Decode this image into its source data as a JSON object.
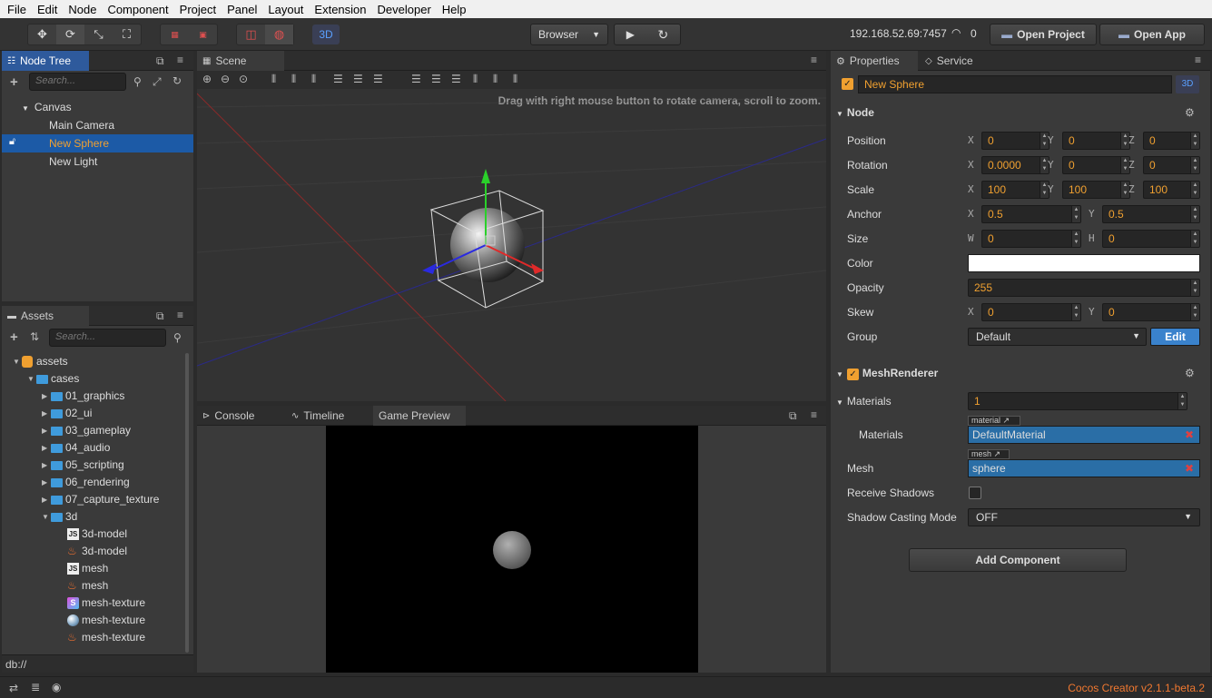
{
  "menu": [
    "File",
    "Edit",
    "Node",
    "Component",
    "Project",
    "Panel",
    "Layout",
    "Extension",
    "Developer",
    "Help"
  ],
  "toolbar": {
    "mode_3d": "3D",
    "preview_target": "Browser",
    "ip_address": "192.168.52.69:7457",
    "connections": "0",
    "open_project": "Open Project",
    "open_app": "Open App"
  },
  "node_tree": {
    "tab": "Node Tree",
    "search_placeholder": "Search...",
    "root": "Canvas",
    "children": [
      "Main Camera",
      "New Sphere",
      "New Light"
    ],
    "selected": "New Sphere"
  },
  "assets": {
    "tab": "Assets",
    "search_placeholder": "Search...",
    "items": [
      {
        "label": "assets",
        "kind": "root"
      },
      {
        "label": "cases",
        "kind": "folder"
      },
      {
        "label": "01_graphics",
        "kind": "folder"
      },
      {
        "label": "02_ui",
        "kind": "folder"
      },
      {
        "label": "03_gameplay",
        "kind": "folder"
      },
      {
        "label": "04_audio",
        "kind": "folder"
      },
      {
        "label": "05_scripting",
        "kind": "folder"
      },
      {
        "label": "06_rendering",
        "kind": "folder"
      },
      {
        "label": "07_capture_texture",
        "kind": "folder"
      },
      {
        "label": "3d",
        "kind": "folder"
      },
      {
        "label": "3d-model",
        "kind": "js"
      },
      {
        "label": "3d-model",
        "kind": "fire"
      },
      {
        "label": "mesh",
        "kind": "js"
      },
      {
        "label": "mesh",
        "kind": "fire"
      },
      {
        "label": "mesh-texture",
        "kind": "shader"
      },
      {
        "label": "mesh-texture",
        "kind": "material"
      },
      {
        "label": "mesh-texture",
        "kind": "fire"
      }
    ],
    "path": "db://"
  },
  "scene": {
    "tab": "Scene",
    "hint": "Drag with right mouse button to rotate camera, scroll to zoom."
  },
  "bottom_tabs": [
    "Console",
    "Timeline",
    "Game Preview"
  ],
  "properties": {
    "tab": "Properties",
    "tab2": "Service",
    "node_name": "New Sphere",
    "badge_3d": "3D",
    "node_section": "Node",
    "position": {
      "label": "Position",
      "x": "0",
      "y": "0",
      "z": "0"
    },
    "rotation": {
      "label": "Rotation",
      "x": "0.0000",
      "y": "0",
      "z": "0"
    },
    "scale": {
      "label": "Scale",
      "x": "100",
      "y": "100",
      "z": "100"
    },
    "anchor": {
      "label": "Anchor",
      "x": "0.5",
      "y": "0.5"
    },
    "size": {
      "label": "Size",
      "w": "0",
      "h": "0"
    },
    "color": {
      "label": "Color",
      "value": "#ffffff"
    },
    "opacity": {
      "label": "Opacity",
      "value": "255"
    },
    "skew": {
      "label": "Skew",
      "x": "0",
      "y": "0"
    },
    "group": {
      "label": "Group",
      "value": "Default",
      "edit": "Edit"
    },
    "mesh_renderer": "MeshRenderer",
    "materials_count_label": "Materials",
    "materials_count": "1",
    "materials_label": "Materials",
    "material_tag": "material",
    "material_value": "DefaultMaterial",
    "mesh_label": "Mesh",
    "mesh_tag": "mesh",
    "mesh_value": "sphere",
    "receive_shadows": "Receive Shadows",
    "shadow_casting_label": "Shadow Casting Mode",
    "shadow_casting_value": "OFF",
    "add_component": "Add Component"
  },
  "status": {
    "version": "Cocos Creator v2.1.1-beta.2"
  },
  "colors": {
    "accent_orange": "#f0a030",
    "selection_blue": "#1c5aa6",
    "asset_blue": "#2a6ea6"
  }
}
